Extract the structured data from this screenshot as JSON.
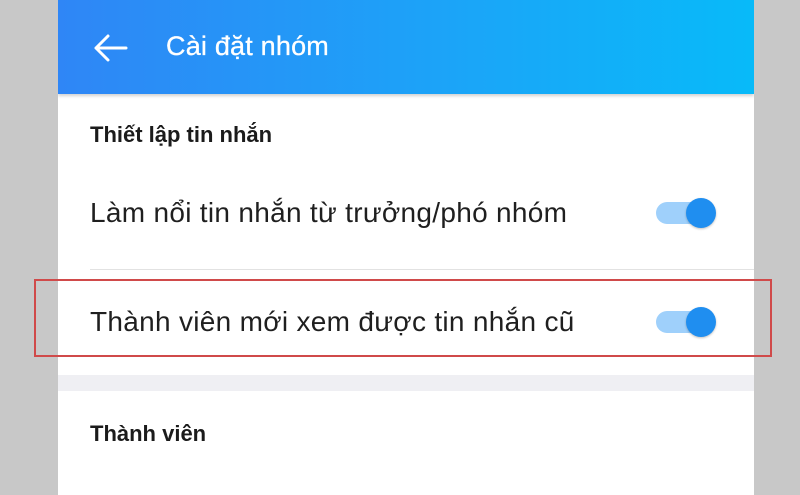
{
  "header": {
    "title": "Cài đặt nhóm",
    "back_icon": "arrow-left-icon",
    "gradient": [
      "#2f86f6",
      "#08baf9"
    ]
  },
  "message_settings": {
    "title": "Thiết lập tin nhắn",
    "items": [
      {
        "label": "Làm nổi tin nhắn từ trưởng/phó nhóm",
        "enabled": true
      },
      {
        "label": "Thành viên mới xem được tin nhắn cũ",
        "enabled": true
      }
    ]
  },
  "members": {
    "title": "Thành viên"
  },
  "colors": {
    "toggle_on": "#1f8ef0",
    "toggle_track": "#9fd0fb",
    "highlight": "#d04a4a"
  }
}
